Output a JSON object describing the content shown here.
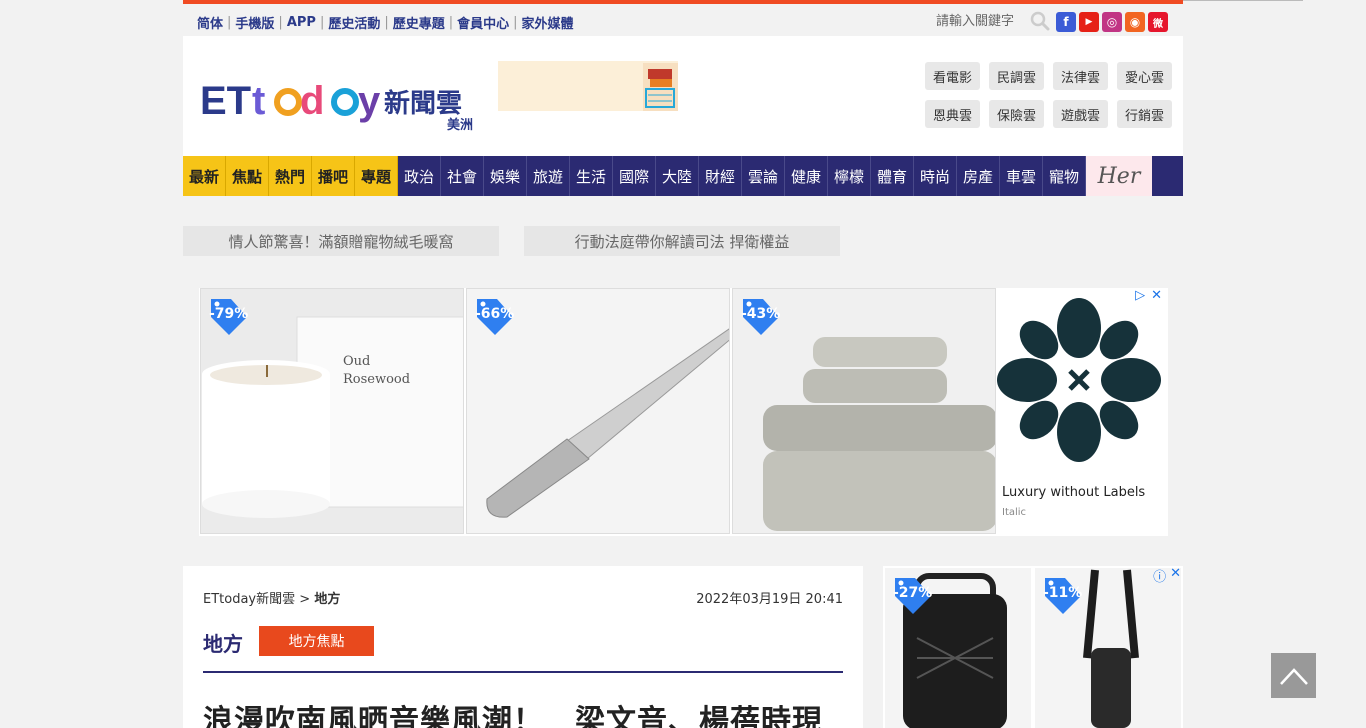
{
  "topbar": {
    "links": [
      "简体",
      "手機版",
      "APP",
      "歷史活動",
      "歷史專題",
      "會員中心",
      "家外媒體"
    ],
    "search_placeholder": "請輸入關鍵字",
    "social": [
      "f",
      "▶",
      "◎",
      "◉",
      "微"
    ]
  },
  "header": {
    "logo_text": "ETtoday新聞雲",
    "edition": "美洲",
    "clouds": [
      "看電影",
      "民調雲",
      "法律雲",
      "愛心雲",
      "恩典雲",
      "保險雲",
      "遊戲雲",
      "行銷雲"
    ]
  },
  "nav": {
    "highlight_items": [
      "最新",
      "焦點",
      "熱門",
      "播吧",
      "專題"
    ],
    "items": [
      "政治",
      "社會",
      "娛樂",
      "旅遊",
      "生活",
      "國際",
      "大陸",
      "財經",
      "雲論",
      "健康",
      "檸檬",
      "體育",
      "時尚",
      "房產",
      "車雲",
      "寵物"
    ],
    "her_label": "Her"
  },
  "promos": [
    "情人節驚喜！滿額贈寵物絨毛暖窩",
    "行動法庭帶你解讀司法 捍衛權益"
  ],
  "ad": {
    "discounts": [
      "-79%",
      "-66%",
      "-43%"
    ],
    "candle_text_1": "Oud",
    "candle_text_2": "Rosewood",
    "brand_title": "Luxury without Labels",
    "brand_sub": "Italic",
    "play_icon": "▷",
    "close_icon": "✕"
  },
  "article": {
    "breadcrumb_root": "ETtoday新聞雲",
    "breadcrumb_sep": ">",
    "breadcrumb_current": "地方",
    "date": "2022年03月19日 20:41",
    "section": "地方",
    "section_tag": "地方焦點",
    "headline": "浪漫吹南風晒音樂風潮！　梁文音、楊蓓時現"
  },
  "side_ad": {
    "discounts": [
      "-27%",
      "-11%"
    ],
    "info_icon": "ⓘ",
    "close_icon": "✕"
  },
  "colors": {
    "brand_navy": "#2b2a72",
    "accent_orange": "#e8491d",
    "nav_highlight": "#f6c417"
  }
}
